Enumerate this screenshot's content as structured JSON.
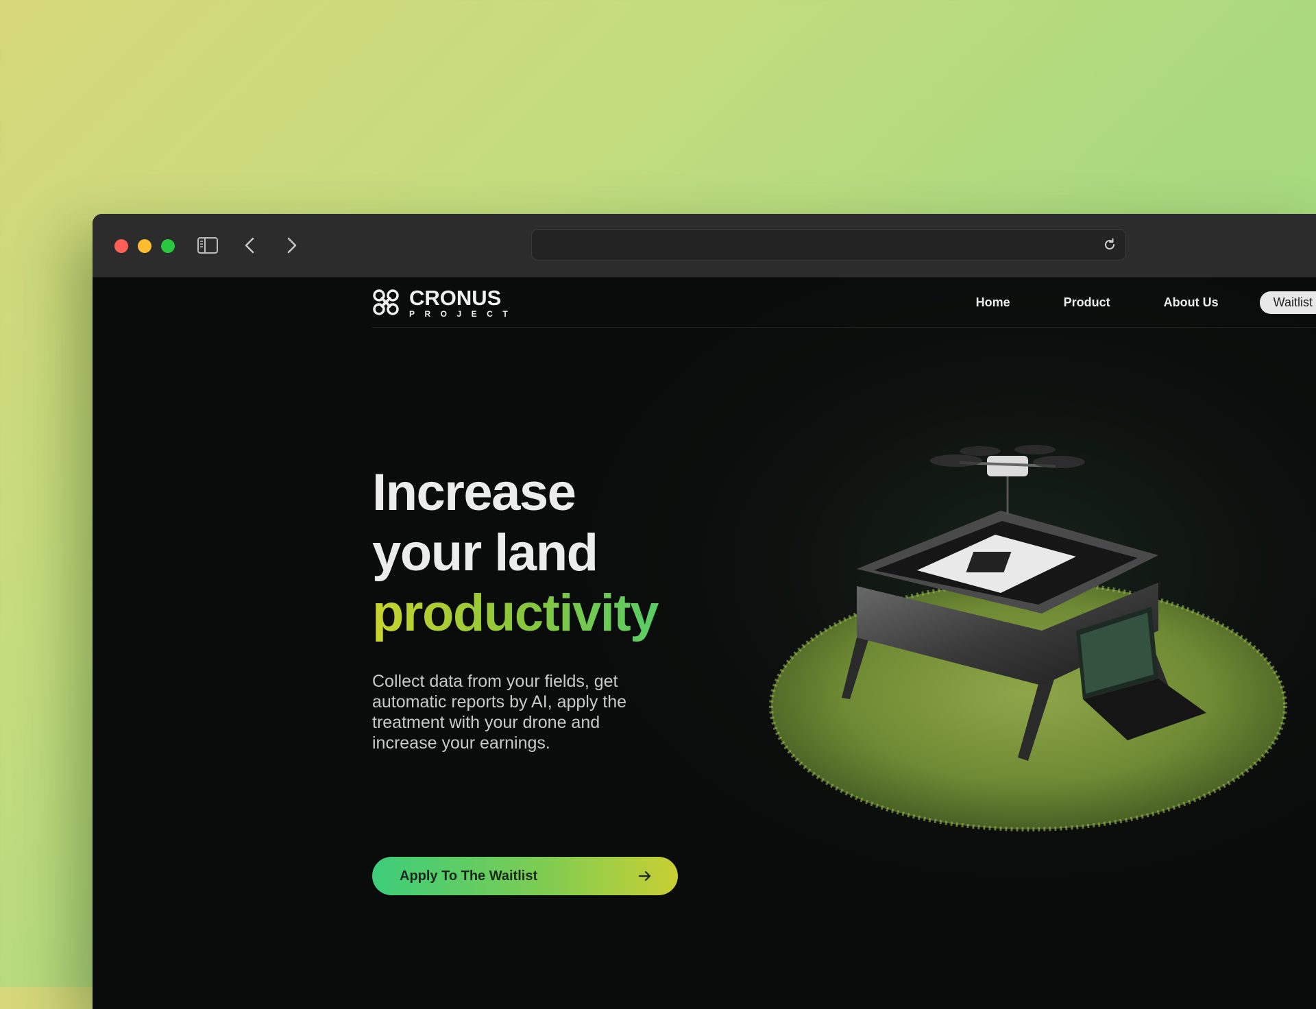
{
  "browser": {
    "address": ""
  },
  "nav": {
    "brand_main": "CRONUS",
    "brand_sub": "PROJECT",
    "links": [
      {
        "label": "Home"
      },
      {
        "label": "Product"
      },
      {
        "label": "About Us"
      }
    ],
    "waitlist_label": "Waitlist"
  },
  "hero": {
    "headline_line1": "Increase",
    "headline_line2": "your land",
    "headline_accent": "productivity",
    "subtext": "Collect data from your fields, get automatic reports by AI, apply the treatment with your drone and increase your earnings.",
    "cta_label": "Apply To The Waitlist"
  },
  "colors": {
    "accent_start": "#c8d42d",
    "accent_end": "#3fcf7b",
    "page_bg": "#0b0d0c"
  },
  "icons": [
    "close-dot",
    "minimize-dot",
    "zoom-dot",
    "sidebar-icon",
    "chevron-left-icon",
    "chevron-right-icon",
    "reload-icon",
    "drone-logo-icon",
    "arrow-right-icon"
  ]
}
